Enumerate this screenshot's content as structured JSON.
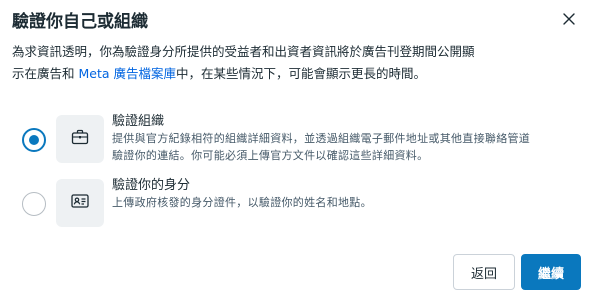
{
  "dialog": {
    "title": "驗證你自己或組織",
    "close_icon": "close-icon",
    "description": {
      "line1": "為求資訊透明，你為驗證身分所提供的受益者和出資者資訊將於廣告刊登期間公開顯",
      "line2_before": "示在廣告和 ",
      "link_text": "Meta 廣告檔案庫",
      "line2_after": "中，在某些情況下，可能會顯示更長的時間。"
    },
    "options": [
      {
        "title": "驗證組織",
        "desc_line1": "提供與官方紀錄相符的組織詳細資料，並透過組織電子郵件地址或其他直接聯絡管道",
        "desc_line2": "驗證你的連結。你可能必須上傳官方文件以確認這些詳細資料。",
        "icon": "briefcase-icon",
        "selected": true
      },
      {
        "title": "驗證你的身分",
        "desc_line1": "上傳政府核發的身分證件，以驗證你的姓名和地點。",
        "icon": "id-card-icon",
        "selected": false
      }
    ],
    "buttons": {
      "back": "返回",
      "next": "繼續"
    },
    "colors": {
      "primary": "#0a78be",
      "link": "#0064e0",
      "text": "#1c2b33",
      "icon_bg": "#eef1f3"
    }
  }
}
